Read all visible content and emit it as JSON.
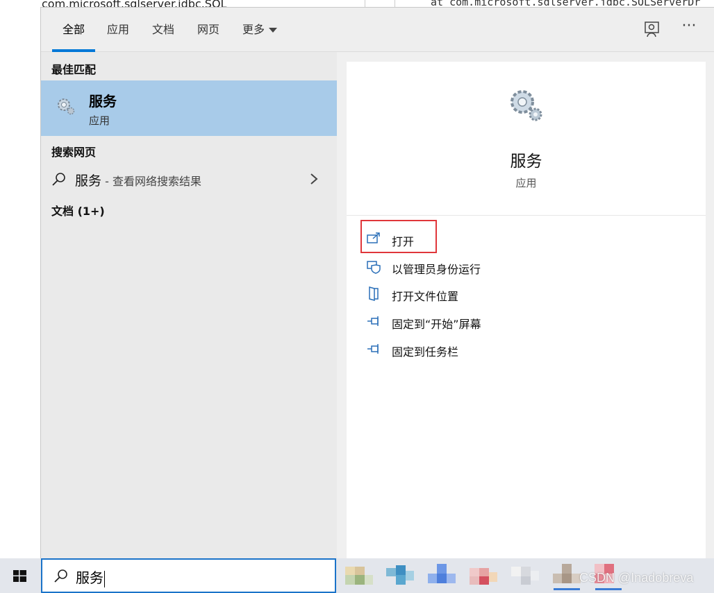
{
  "background": {
    "top_left_text": "com.microsoft.sqlserver.jdbc.SQL",
    "top_right_text": "at com.microsoft.sqlserver.jdbc.SQLServerDr"
  },
  "tabs": [
    {
      "label": "全部",
      "active": true
    },
    {
      "label": "应用",
      "active": false
    },
    {
      "label": "文档",
      "active": false
    },
    {
      "label": "网页",
      "active": false
    },
    {
      "label": "更多",
      "active": false
    }
  ],
  "header_icons": {
    "feedback": "feedback-person-icon",
    "more": "···"
  },
  "results": {
    "best_match_title": "最佳匹配",
    "best_match": {
      "name": "服务",
      "type": "应用",
      "icon": "services-gears-icon"
    },
    "web_title": "搜索网页",
    "web_result": {
      "query": "服务",
      "suffix": " - 查看网络搜索结果"
    },
    "documents_title": "文档 (1+)"
  },
  "detail": {
    "name": "服务",
    "type": "应用",
    "actions": [
      {
        "label": "打开",
        "icon": "open-icon"
      },
      {
        "label": "以管理员身份运行",
        "icon": "shield-run-admin-icon"
      },
      {
        "label": "打开文件位置",
        "icon": "file-location-icon"
      },
      {
        "label": "固定到“开始”屏幕",
        "icon": "pin-icon"
      },
      {
        "label": "固定到任务栏",
        "icon": "pin-icon"
      }
    ],
    "highlight_color": "#e0363a"
  },
  "taskbar": {
    "search_value": "服务",
    "watermark": "CSDN @Inadobreva",
    "accent": "#1a73c9"
  },
  "colors": {
    "selected_row": "#a8cbe9",
    "tab_accent": "#0078d7"
  }
}
